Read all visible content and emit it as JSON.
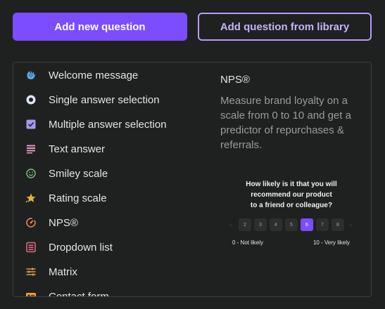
{
  "toolbar": {
    "add_new_label": "Add new question",
    "add_library_label": "Add question from library"
  },
  "question_types": [
    {
      "label": "Welcome message",
      "icon": "wave-hand-icon",
      "color": "#5fa8e8"
    },
    {
      "label": "Single answer selection",
      "icon": "radio-icon",
      "color": "#8fb4e6"
    },
    {
      "label": "Multiple answer selection",
      "icon": "checkbox-icon",
      "color": "#a79ae8"
    },
    {
      "label": "Text answer",
      "icon": "text-lines-icon",
      "color": "#e59ac6"
    },
    {
      "label": "Smiley scale",
      "icon": "smiley-icon",
      "color": "#7dbf7f"
    },
    {
      "label": "Rating scale",
      "icon": "star-icon",
      "color": "#e0b24a"
    },
    {
      "label": "NPS®",
      "icon": "nps-gauge-icon",
      "color": "#ef8a56"
    },
    {
      "label": "Dropdown list",
      "icon": "dropdown-list-icon",
      "color": "#e36a82"
    },
    {
      "label": "Matrix",
      "icon": "sliders-icon",
      "color": "#d99955"
    },
    {
      "label": "Contact form",
      "icon": "contact-card-icon",
      "color": "#e6a23c"
    }
  ],
  "detail": {
    "title": "NPS®",
    "description": "Measure brand loyalty on a scale from 0 to 10 and get a predictor of repurchases & referrals."
  },
  "preview": {
    "question_line_1": "How likely is it that you will",
    "question_line_2": "recommend our product",
    "question_line_3": "to a friend or colleague?",
    "scale_values": [
      "2",
      "3",
      "4",
      "5",
      "6",
      "7",
      "8"
    ],
    "selected_value": "6",
    "low_label": "0 - Not likely",
    "high_label": "10 - Very likely"
  }
}
